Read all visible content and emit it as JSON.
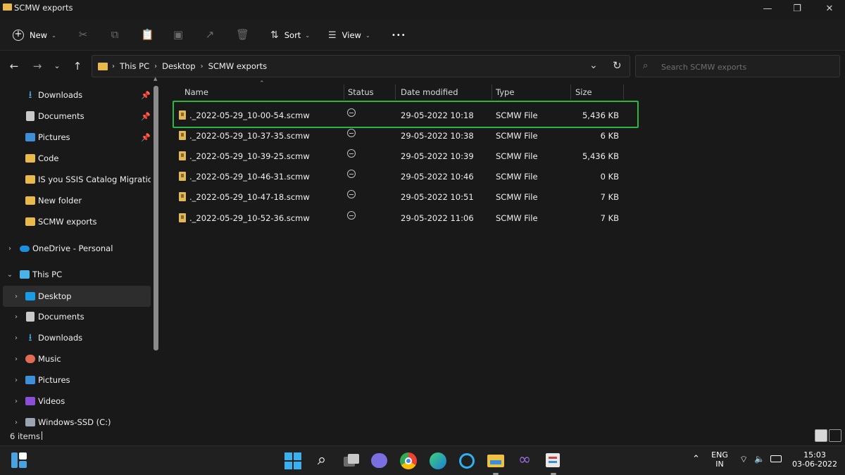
{
  "window": {
    "title": "SCMW exports"
  },
  "toolbar": {
    "new_label": "New",
    "sort_label": "Sort",
    "view_label": "View",
    "more_label": "•••"
  },
  "address": {
    "crumbs": [
      "This PC",
      "Desktop",
      "SCMW exports"
    ]
  },
  "search": {
    "placeholder": "Search SCMW exports"
  },
  "sidebar": {
    "quick": [
      {
        "label": "Downloads",
        "icon": "download-icon",
        "pinned": true
      },
      {
        "label": "Documents",
        "icon": "documents-icon",
        "pinned": true
      },
      {
        "label": "Pictures",
        "icon": "pictures-icon",
        "pinned": true
      },
      {
        "label": "Code",
        "icon": "folder-icon",
        "pinned": false
      },
      {
        "label": "IS you SSIS Catalog Migration re",
        "icon": "folder-icon",
        "pinned": false
      },
      {
        "label": "New folder",
        "icon": "folder-icon",
        "pinned": false
      },
      {
        "label": "SCMW exports",
        "icon": "folder-icon",
        "pinned": false
      }
    ],
    "onedrive": "OneDrive - Personal",
    "thispc": "This PC",
    "pc_items": [
      {
        "label": "Desktop",
        "icon": "desktop-icon",
        "selected": true
      },
      {
        "label": "Documents",
        "icon": "documents-icon"
      },
      {
        "label": "Downloads",
        "icon": "download-icon"
      },
      {
        "label": "Music",
        "icon": "music-icon"
      },
      {
        "label": "Pictures",
        "icon": "pictures-icon"
      },
      {
        "label": "Videos",
        "icon": "videos-icon"
      },
      {
        "label": "Windows-SSD (C:)",
        "icon": "drive-icon"
      }
    ]
  },
  "columns": {
    "name": "Name",
    "status": "Status",
    "date": "Date modified",
    "type": "Type",
    "size": "Size"
  },
  "files": [
    {
      "name": "._2022-05-29_10-00-54.scmw",
      "date": "29-05-2022 10:18",
      "type": "SCMW File",
      "size": "5,436 KB"
    },
    {
      "name": "._2022-05-29_10-37-35.scmw",
      "date": "29-05-2022 10:38",
      "type": "SCMW File",
      "size": "6 KB"
    },
    {
      "name": "._2022-05-29_10-39-25.scmw",
      "date": "29-05-2022 10:39",
      "type": "SCMW File",
      "size": "5,436 KB"
    },
    {
      "name": "._2022-05-29_10-46-31.scmw",
      "date": "29-05-2022 10:46",
      "type": "SCMW File",
      "size": "0 KB"
    },
    {
      "name": "._2022-05-29_10-47-18.scmw",
      "date": "29-05-2022 10:51",
      "type": "SCMW File",
      "size": "7 KB"
    },
    {
      "name": "._2022-05-29_10-52-36.scmw",
      "date": "29-05-2022 11:06",
      "type": "SCMW File",
      "size": "7 KB"
    }
  ],
  "status": {
    "count": "6 items"
  },
  "taskbar": {
    "lang": "ENG",
    "region": "IN",
    "time": "15:03",
    "date": "03-06-2022"
  },
  "colors": {
    "folder": "#e9b949",
    "highlight": "#2db742",
    "accent": "#1a9be6"
  }
}
